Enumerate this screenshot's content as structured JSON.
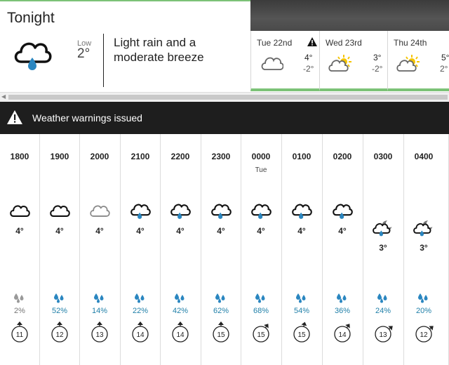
{
  "tonight": {
    "title": "Tonight",
    "icon": "cloud-rain-icon",
    "low_label": "Low",
    "low_value": "2°",
    "summary": "Light rain and a moderate breeze"
  },
  "days": [
    {
      "name": "Tue 22nd",
      "icon": "cloud-icon",
      "high": "4°",
      "low": "-2°",
      "warning": true
    },
    {
      "name": "Wed 23rd",
      "icon": "sun-cloud-icon",
      "high": "3°",
      "low": "-2°",
      "warning": false
    },
    {
      "name": "Thu 24th",
      "icon": "sun-cloud-icon",
      "high": "5°",
      "low": "2°",
      "warning": false
    }
  ],
  "warning_bar": {
    "text": "Weather warnings issued",
    "icon": "warning-triangle-icon"
  },
  "hours": [
    {
      "time": "1800",
      "sub": "",
      "icon": "cloud-icon",
      "temp": "4°",
      "precip": "2%",
      "wind": "11",
      "wind_dir_deg": 0
    },
    {
      "time": "1900",
      "sub": "",
      "icon": "cloud-icon",
      "temp": "4°",
      "precip": "52%",
      "wind": "12",
      "wind_dir_deg": 0
    },
    {
      "time": "2000",
      "sub": "",
      "icon": "cloud-light-icon",
      "temp": "4°",
      "precip": "14%",
      "wind": "13",
      "wind_dir_deg": 0
    },
    {
      "time": "2100",
      "sub": "",
      "icon": "cloud-rain-icon",
      "temp": "4°",
      "precip": "22%",
      "wind": "14",
      "wind_dir_deg": 0
    },
    {
      "time": "2200",
      "sub": "",
      "icon": "cloud-rain-icon",
      "temp": "4°",
      "precip": "42%",
      "wind": "14",
      "wind_dir_deg": 0
    },
    {
      "time": "2300",
      "sub": "",
      "icon": "cloud-rain-icon",
      "temp": "4°",
      "precip": "62%",
      "wind": "15",
      "wind_dir_deg": 0
    },
    {
      "time": "0000",
      "sub": "Tue",
      "icon": "cloud-rain-icon",
      "temp": "4°",
      "precip": "68%",
      "wind": "15",
      "wind_dir_deg": 35
    },
    {
      "time": "0100",
      "sub": "",
      "icon": "cloud-rain-icon",
      "temp": "4°",
      "precip": "54%",
      "wind": "15",
      "wind_dir_deg": 15
    },
    {
      "time": "0200",
      "sub": "",
      "icon": "cloud-rain-icon",
      "temp": "4°",
      "precip": "36%",
      "wind": "14",
      "wind_dir_deg": 35
    },
    {
      "time": "0300",
      "sub": "",
      "icon": "moon-cloud-rain-icon",
      "temp": "3°",
      "precip": "24%",
      "wind": "13",
      "wind_dir_deg": 50
    },
    {
      "time": "0400",
      "sub": "",
      "icon": "moon-cloud-rain-icon",
      "temp": "3°",
      "precip": "20%",
      "wind": "12",
      "wind_dir_deg": 50
    }
  ],
  "colors": {
    "accent_green": "#7cc277",
    "rain_blue": "#1f7fa8",
    "warning_bar_bg": "#1e1e1e",
    "sun_yellow": "#f5c400"
  }
}
